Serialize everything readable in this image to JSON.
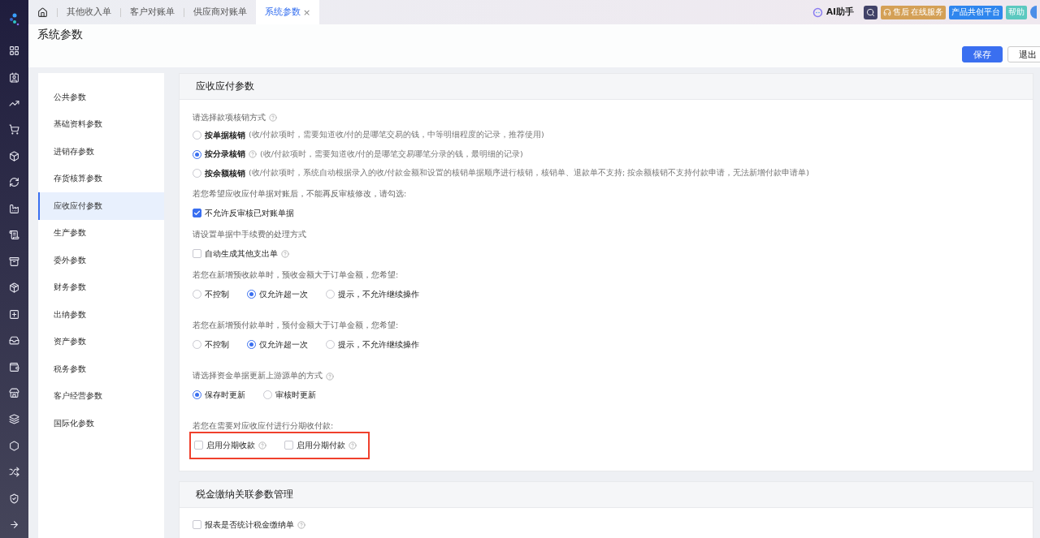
{
  "tabs": [
    {
      "label": "其他收入单",
      "selected": false
    },
    {
      "label": "客户对账单",
      "selected": false
    },
    {
      "label": "供应商对账单",
      "selected": false
    },
    {
      "label": "系统参数",
      "selected": true,
      "close": "×"
    }
  ],
  "header_tools": {
    "ai": "AI助手",
    "service": "售后",
    "service_sub": "在线服务",
    "platform": "产品共创平台",
    "help": "帮助"
  },
  "page_title": "系统参数",
  "buttons": [
    {
      "label": "保存",
      "kind": "primary"
    },
    {
      "label": "退出",
      "kind": "default"
    }
  ],
  "menu": [
    {
      "label": "公共参数",
      "selected": false
    },
    {
      "label": "基础资料参数",
      "selected": false
    },
    {
      "label": "进销存参数",
      "selected": false
    },
    {
      "label": "存货核算参数",
      "selected": false
    },
    {
      "label": "应收应付参数",
      "selected": true
    },
    {
      "label": "生产参数",
      "selected": false
    },
    {
      "label": "委外参数",
      "selected": false
    },
    {
      "label": "财务参数",
      "selected": false
    },
    {
      "label": "出纳参数",
      "selected": false
    },
    {
      "label": "资产参数",
      "selected": false
    },
    {
      "label": "税务参数",
      "selected": false
    },
    {
      "label": "客户经营参数",
      "selected": false
    },
    {
      "label": "国际化参数",
      "selected": false
    }
  ],
  "sections": [
    {
      "title": "应收应付参数",
      "rows": [
        {
          "kind": "label",
          "text": "请选择款项核销方式",
          "help": true
        },
        {
          "kind": "radio-list",
          "options": [
            {
              "label": "按单据核销",
              "note": "(收/付款项时，需要知道收/付的是哪笔交易的钱，中等明细程度的记录，推荐使用)",
              "help": false,
              "selected": false
            },
            {
              "label": "按分录核销",
              "note": "(收/付款项时，需要知道收/付的是哪笔交易哪笔分录的钱，最明细的记录)",
              "help": true,
              "selected": true
            },
            {
              "label": "按余额核销",
              "note": "(收/付款项时，系统自动根据录入的收/付款金额和设置的核销单据顺序进行核销，核销单、退款单不支持; 按余额核销不支持付款申请，无法新增付款申请单)",
              "help": false,
              "selected": false
            }
          ]
        },
        {
          "kind": "label",
          "text": "若您希望应收应付单据对账后，不能再反审核修改，请勾选:",
          "help": false
        },
        {
          "kind": "checks",
          "highlighted": false,
          "options": [
            {
              "label": "不允许反审核已对账单据",
              "checked": true,
              "help": false
            }
          ]
        },
        {
          "kind": "label",
          "text": "请设置单据中手续费的处理方式",
          "help": false
        },
        {
          "kind": "checks",
          "highlighted": false,
          "options": [
            {
              "label": "自动生成其他支出单",
              "checked": false,
              "help": true
            }
          ]
        },
        {
          "kind": "label",
          "text": "若您在新增预收款单时，预收金额大于订单金额，您希望:",
          "help": false
        },
        {
          "kind": "radios",
          "options": [
            {
              "label": "不控制",
              "selected": false
            },
            {
              "label": "仅允许超一次",
              "selected": true
            },
            {
              "label": "提示，不允许继续操作",
              "selected": false
            }
          ]
        },
        {
          "kind": "label",
          "text": "若您在新增预付款单时，预付金额大于订单金额，您希望:",
          "help": false
        },
        {
          "kind": "radios",
          "options": [
            {
              "label": "不控制",
              "selected": false
            },
            {
              "label": "仅允许超一次",
              "selected": true
            },
            {
              "label": "提示，不允许继续操作",
              "selected": false
            }
          ]
        },
        {
          "kind": "label",
          "text": "请选择资金单据更新上游源单的方式",
          "help": true
        },
        {
          "kind": "radios",
          "options": [
            {
              "label": "保存时更新",
              "selected": true
            },
            {
              "label": "审核时更新",
              "selected": false
            }
          ]
        },
        {
          "kind": "label",
          "text": "若您在需要对应收应付进行分期收付款:",
          "help": false
        },
        {
          "kind": "checks",
          "highlighted": true,
          "options": [
            {
              "label": "启用分期收款",
              "checked": false,
              "help": true
            },
            {
              "label": "启用分期付款",
              "checked": false,
              "help": true
            }
          ]
        }
      ]
    },
    {
      "title": "税金缴纳关联参数管理",
      "rows": [
        {
          "kind": "checks",
          "highlighted": false,
          "options": [
            {
              "label": "报表是否统计税金缴纳单",
              "checked": false,
              "help": true
            }
          ]
        }
      ]
    }
  ]
}
